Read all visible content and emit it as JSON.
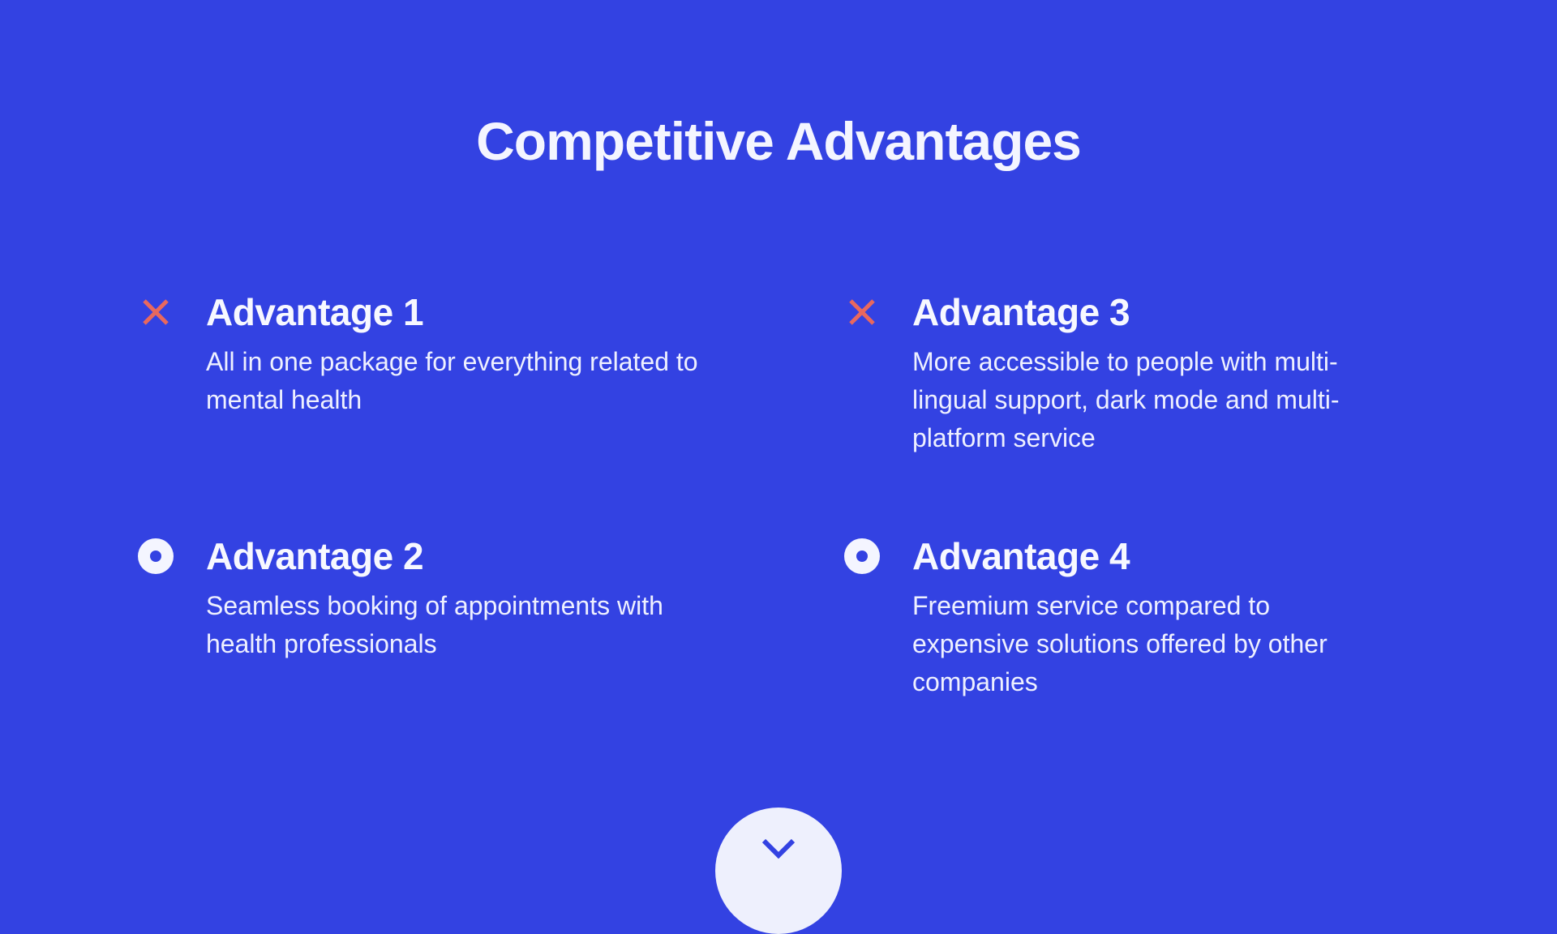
{
  "slide": {
    "title": "Competitive Advantages",
    "colors": {
      "background": "#3342E2",
      "text": "#F4F5FF",
      "accent_x": "#E8685E",
      "button": "#EEF0FD"
    },
    "advantages": [
      {
        "heading": "Advantage 1",
        "body": "All in one package for everything related to mental health",
        "icon": "x-icon"
      },
      {
        "heading": "Advantage 2",
        "body": "Seamless booking of appointments with health professionals",
        "icon": "ring-icon"
      },
      {
        "heading": "Advantage 3",
        "body": "More accessible to people with  multi-lingual support, dark mode and multi-platform service",
        "icon": "x-icon"
      },
      {
        "heading": "Advantage 4",
        "body": "Freemium service compared to expensive solutions offered by other companies",
        "icon": "ring-icon"
      }
    ],
    "scroll_button": {
      "icon": "chevron-down-icon"
    }
  }
}
